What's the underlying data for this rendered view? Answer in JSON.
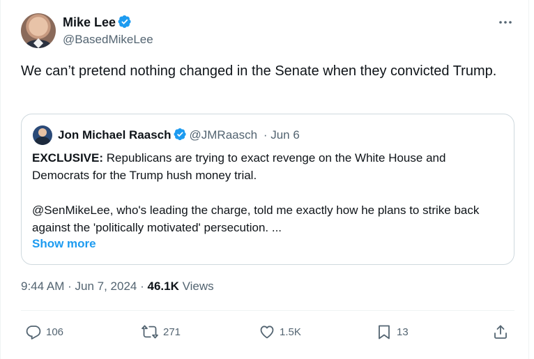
{
  "author": {
    "name": "Mike Lee",
    "handle": "@BasedMikeLee",
    "avatar": "avatar"
  },
  "tweet_text": "We can’t pretend nothing changed in the Senate when they convicted Trump.",
  "quoted": {
    "name": "Jon Michael Raasch",
    "handle": "@JMRaasch",
    "separator": "·",
    "date": "Jun 6",
    "lead": "EXCLUSIVE:",
    "body1": " Republicans are trying to exact revenge on the White House and Democrats for the Trump hush money trial.",
    "body2": "@SenMikeLee, who's leading the charge, told me exactly how he plans to strike back against the 'politically motivated' persecution. ...",
    "show_more": "Show more"
  },
  "meta": {
    "time": "9:44 AM",
    "separator": "·",
    "date": "Jun 7, 2024",
    "separator2": "·",
    "views": "46.1K",
    "views_label": "Views"
  },
  "actions": {
    "replies": "106",
    "retweets": "271",
    "likes": "1.5K",
    "bookmarks": "13"
  },
  "icons": [
    "verified-badge-icon",
    "more-icon",
    "reply-icon",
    "retweet-icon",
    "like-icon",
    "bookmark-icon",
    "share-icon"
  ],
  "colors": {
    "accent": "#1d9bf0",
    "text": "#0f1419",
    "muted": "#536471",
    "border": "#cfd9de"
  }
}
